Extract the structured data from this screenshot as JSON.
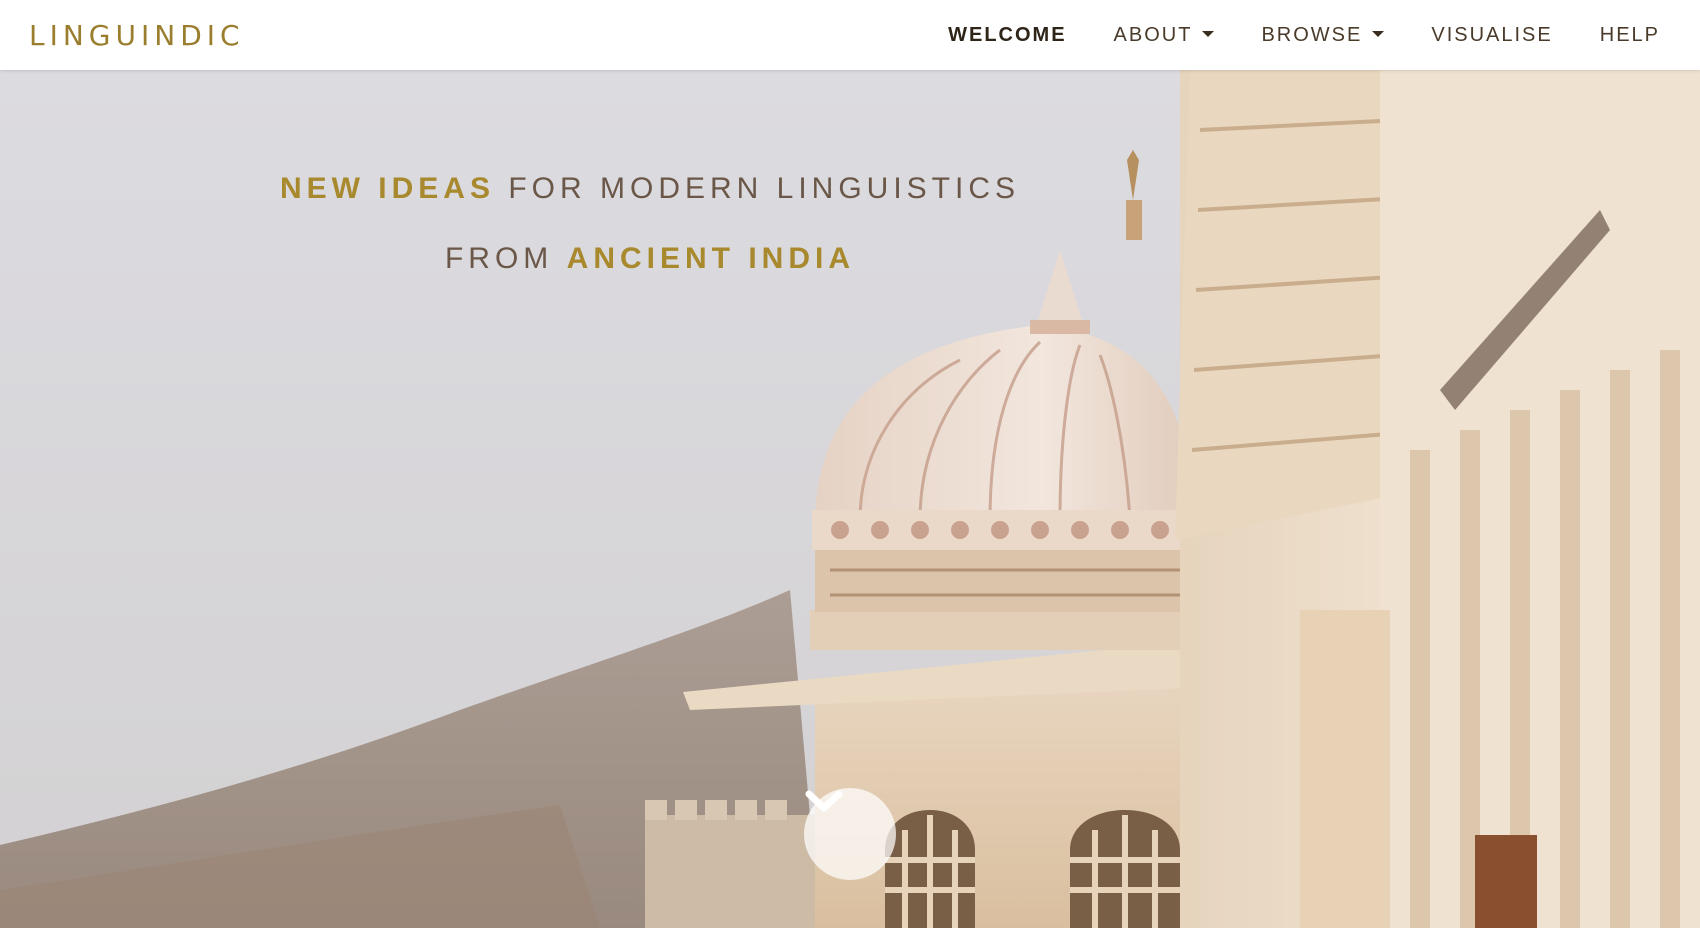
{
  "brand": {
    "name": "LINGUINDIC"
  },
  "nav": {
    "items": [
      {
        "label": "WELCOME",
        "active": true,
        "dropdown": false
      },
      {
        "label": "ABOUT",
        "active": false,
        "dropdown": true
      },
      {
        "label": "BROWSE",
        "active": false,
        "dropdown": true
      },
      {
        "label": "VISUALISE",
        "active": false,
        "dropdown": false
      },
      {
        "label": "HELP",
        "active": false,
        "dropdown": false
      }
    ]
  },
  "hero": {
    "line1": {
      "accent": "NEW IDEAS",
      "rest": "FOR MODERN LINGUISTICS"
    },
    "line2": {
      "lead": "FROM",
      "accent": "ANCIENT INDIA"
    },
    "scroll_icon": "chevron-down-icon"
  },
  "colors": {
    "brand": "#9a7e2e",
    "accent": "#a8892d",
    "text": "#6a5748",
    "sky": "#d9d8dc"
  }
}
